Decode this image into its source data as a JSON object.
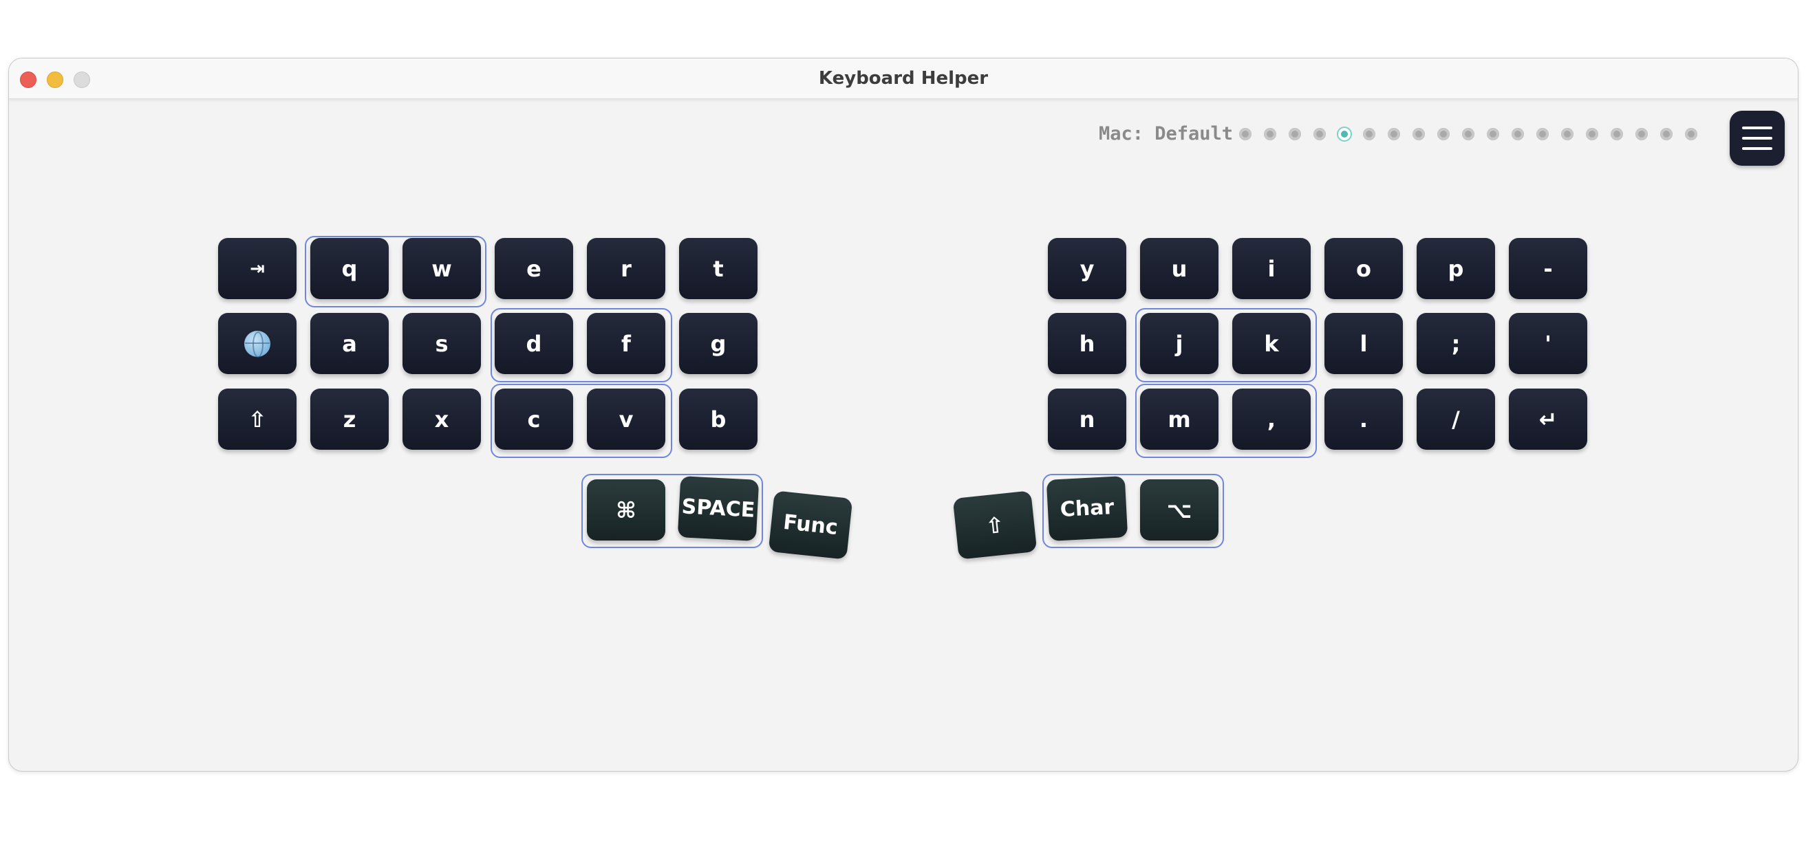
{
  "window": {
    "title": "Keyboard Helper"
  },
  "layout": {
    "name": "Mac: Default",
    "page_count": 19,
    "active_index": 4
  },
  "left_hand": {
    "row1": [
      "⇥",
      "q",
      "w",
      "e",
      "r",
      "t"
    ],
    "row2": [
      "globe-icon",
      "a",
      "s",
      "d",
      "f",
      "g"
    ],
    "row3": [
      "⇧",
      "z",
      "x",
      "c",
      "v",
      "b"
    ],
    "thumbs": [
      "⌘",
      "SPACE",
      "Func"
    ]
  },
  "right_hand": {
    "row1": [
      "y",
      "u",
      "i",
      "o",
      "p",
      "-"
    ],
    "row2": [
      "h",
      "j",
      "k",
      "l",
      ";",
      "'"
    ],
    "row3": [
      "n",
      "m",
      ",",
      ".",
      "/",
      "↵"
    ],
    "thumbs": [
      "⇧",
      "Char",
      "⌥"
    ]
  },
  "colors": {
    "key": "#1b1f30",
    "thumb_key": "#213032",
    "combo_outline": "#6f86e0",
    "active_dot": "#4fb8b4"
  }
}
